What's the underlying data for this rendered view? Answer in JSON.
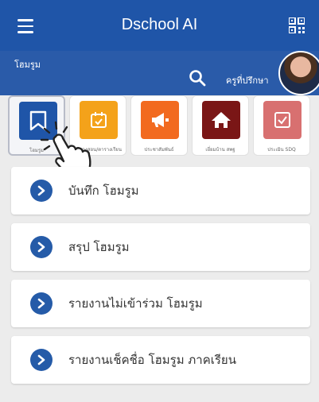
{
  "header": {
    "title": "Dschool AI",
    "menu_icon": "hamburger-menu-icon",
    "qr_icon": "qr-code-icon"
  },
  "subheader": {
    "section_label": "โฮมรูม",
    "role_label": "ครูที่ปรึกษา",
    "search_icon": "search-icon"
  },
  "tiles": [
    {
      "caption": "โฮมรูม",
      "icon": "bookmark-icon",
      "color": "#1f55a8",
      "selected": true
    },
    {
      "caption": "ตารางสอน/ตารางเรียน",
      "icon": "calendar-check-icon",
      "color": "#f4a21a"
    },
    {
      "caption": "ประชาสัมพันธ์",
      "icon": "megaphone-icon",
      "color": "#f26a1f"
    },
    {
      "caption": "เยี่ยมบ้าน สพฐ",
      "icon": "home-icon",
      "color": "#7a1616"
    },
    {
      "caption": "ประเมิน SDQ",
      "icon": "checkbox-icon",
      "color": "#d87070"
    }
  ],
  "menu_items": [
    {
      "label": "บันทึก โฮมรูม"
    },
    {
      "label": "สรุป โฮมรูม"
    },
    {
      "label": "รายงานไม่เข้าร่วม โฮมรูม"
    },
    {
      "label": "รายงานเช็คชื่อ โฮมรูม ภาคเรียน"
    }
  ],
  "colors": {
    "primary": "#1f55a8",
    "chevron": "#255ba8",
    "background": "#ececec"
  }
}
